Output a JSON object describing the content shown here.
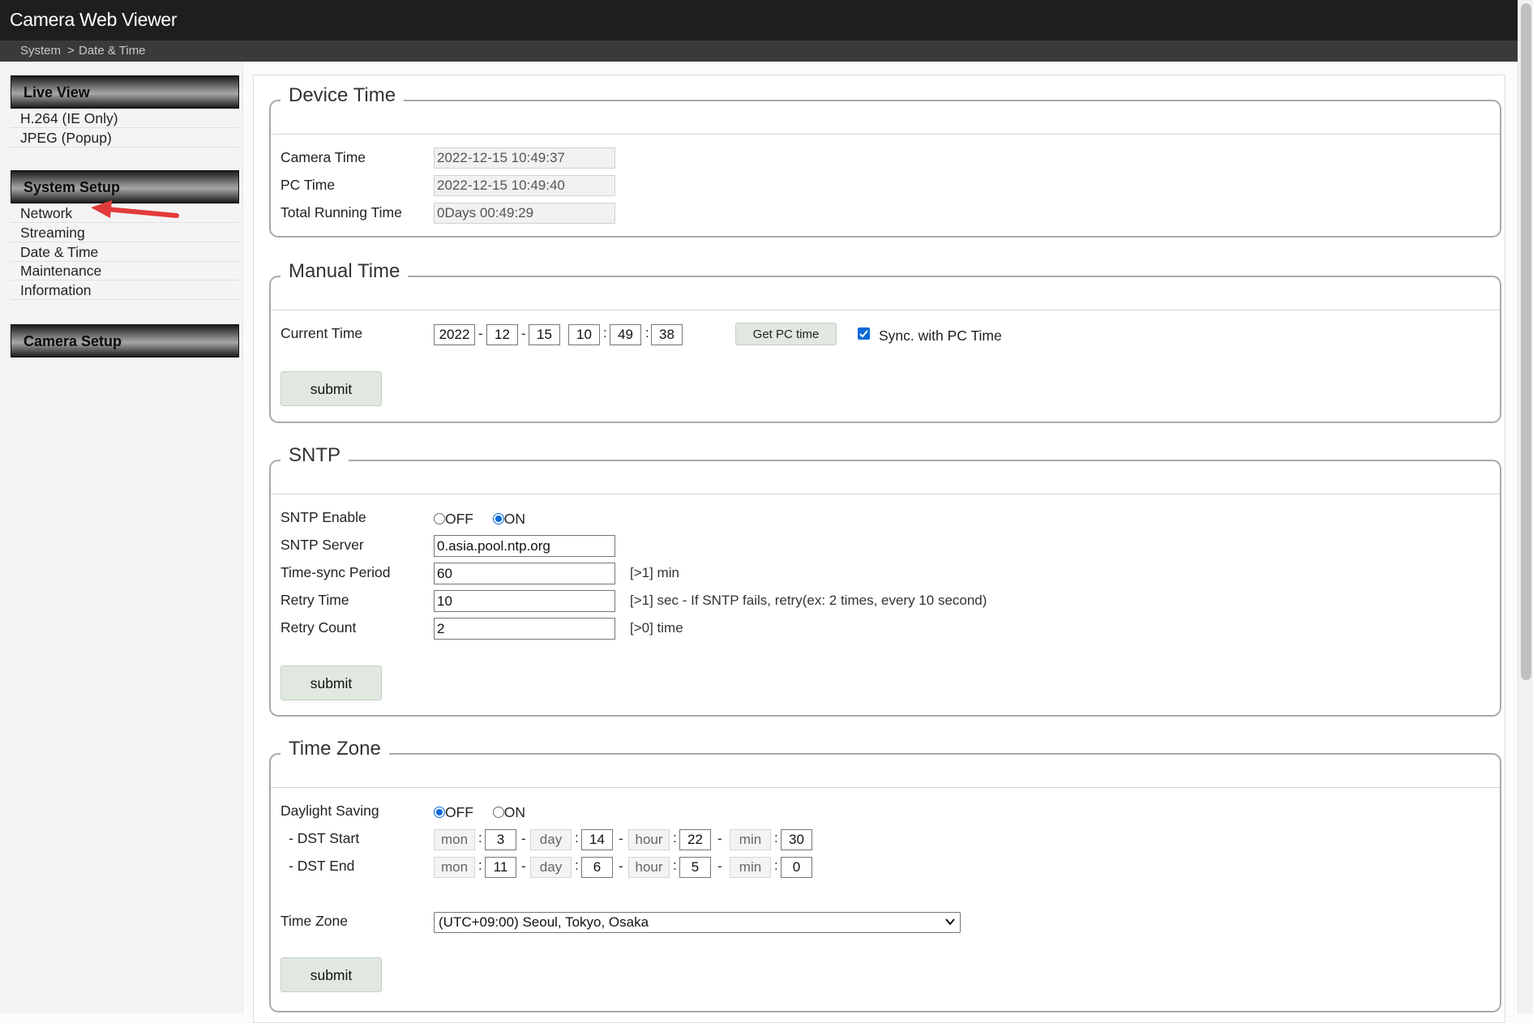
{
  "header": {
    "app_title": "Camera Web Viewer",
    "breadcrumb": {
      "root": "System",
      "separator": ">",
      "current": "Date & Time"
    }
  },
  "sidebar": {
    "live_view": {
      "title": "Live View",
      "items": [
        "H.264 (IE Only)",
        "JPEG  (Popup)"
      ]
    },
    "system_setup": {
      "title": "System Setup",
      "items": [
        "Network",
        "Streaming",
        "Date & Time",
        "Maintenance",
        "Information"
      ]
    },
    "camera_setup": {
      "title": "Camera Setup"
    }
  },
  "device_time": {
    "title": "Device Time",
    "camera_time_label": "Camera Time",
    "camera_time_value": "2022-12-15   10:49:37",
    "pc_time_label": "PC Time",
    "pc_time_value": "2022-12-15   10:49:40",
    "running_label": "Total Running Time",
    "running_value": "0Days  00:49:29"
  },
  "manual_time": {
    "title": "Manual Time",
    "current_time_label": "Current Time",
    "year": "2022",
    "month": "12",
    "day": "15",
    "hour": "10",
    "minute": "49",
    "second": "38",
    "date_sep": "-",
    "time_sep": ":",
    "get_pc_time_label": "Get PC time",
    "sync_label": "Sync. with PC Time",
    "sync_checked": true,
    "submit_label": "submit"
  },
  "sntp": {
    "title": "SNTP",
    "enable_label": "SNTP Enable",
    "off_label": "OFF",
    "on_label": "ON",
    "enabled": "ON",
    "server_label": "SNTP Server",
    "server_value": "0.asia.pool.ntp.org",
    "period_label": "Time-sync Period",
    "period_value": "60",
    "period_hint": "[>1] min",
    "retry_time_label": "Retry Time",
    "retry_time_value": "10",
    "retry_time_hint": "[>1] sec - If SNTP fails, retry(ex: 2 times, every 10 second)",
    "retry_count_label": "Retry Count",
    "retry_count_value": "2",
    "retry_count_hint": "[>0] time",
    "submit_label": "submit"
  },
  "time_zone": {
    "title": "Time Zone",
    "dst_label": "Daylight Saving",
    "off_label": "OFF",
    "on_label": "ON",
    "dst_enabled": "OFF",
    "dst_start_label": "- DST Start",
    "dst_end_label": "- DST End",
    "unit_mon": "mon",
    "unit_day": "day",
    "unit_hour": "hour",
    "unit_min": "min",
    "dst_start": {
      "mon": "3",
      "day": "14",
      "hour": "22",
      "min": "30"
    },
    "dst_end": {
      "mon": "11",
      "day": "6",
      "hour": "5",
      "min": "0"
    },
    "tz_label": "Time Zone",
    "tz_value": "(UTC+09:00) Seoul, Tokyo, Osaka",
    "submit_label": "submit"
  },
  "colors": {
    "accent": "#0b6ad8",
    "arrow": "#e23b3b",
    "header_bg": "#1e1e1e",
    "button_bg": "#e0e8e0"
  }
}
